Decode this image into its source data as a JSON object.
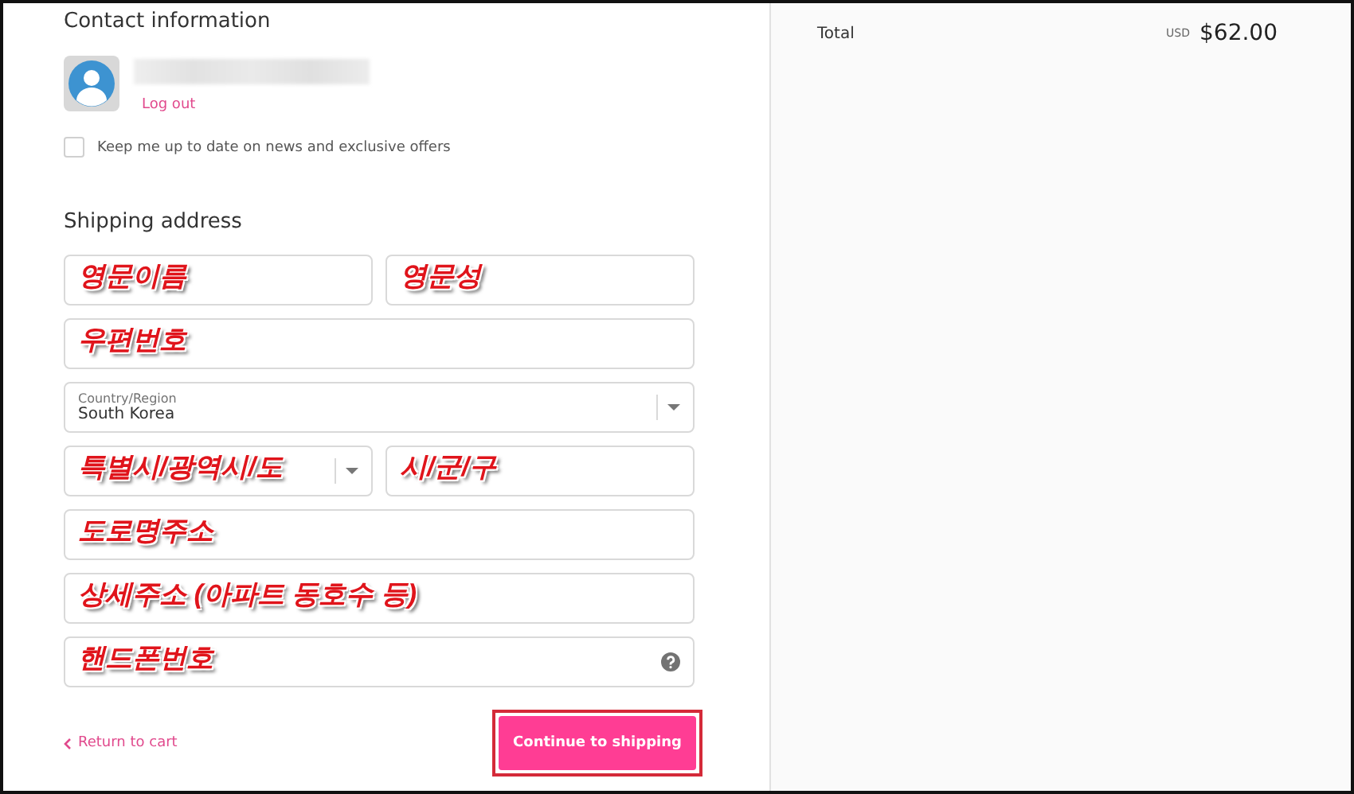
{
  "contact": {
    "title": "Contact information",
    "logout": "Log out",
    "newsletter": {
      "label": "Keep me up to date on news and exclusive offers",
      "checked": false
    }
  },
  "shipping": {
    "title": "Shipping address",
    "rows": [
      [
        {
          "kind": "text",
          "annotation": "영문이름"
        },
        {
          "kind": "text",
          "annotation": "영문성"
        }
      ],
      [
        {
          "kind": "text",
          "annotation": "우편번호"
        }
      ],
      [
        {
          "kind": "select",
          "label": "Country/Region",
          "value": "South Korea"
        }
      ],
      [
        {
          "kind": "select",
          "annotation": "특별시/광역시/도"
        },
        {
          "kind": "text",
          "annotation": "시/군/구"
        }
      ],
      [
        {
          "kind": "text",
          "annotation": "도로명주소"
        }
      ],
      [
        {
          "kind": "text",
          "annotation": "상세주소 (아파트 동호수 등)"
        }
      ],
      [
        {
          "kind": "text",
          "annotation": "핸드폰번호",
          "help": true
        }
      ]
    ]
  },
  "footer": {
    "return_link": "Return to cart",
    "continue_button": {
      "label": "Continue to shipping",
      "highlighted": true
    }
  },
  "summary": {
    "total_label": "Total",
    "currency": "USD",
    "amount": "$62.00"
  }
}
